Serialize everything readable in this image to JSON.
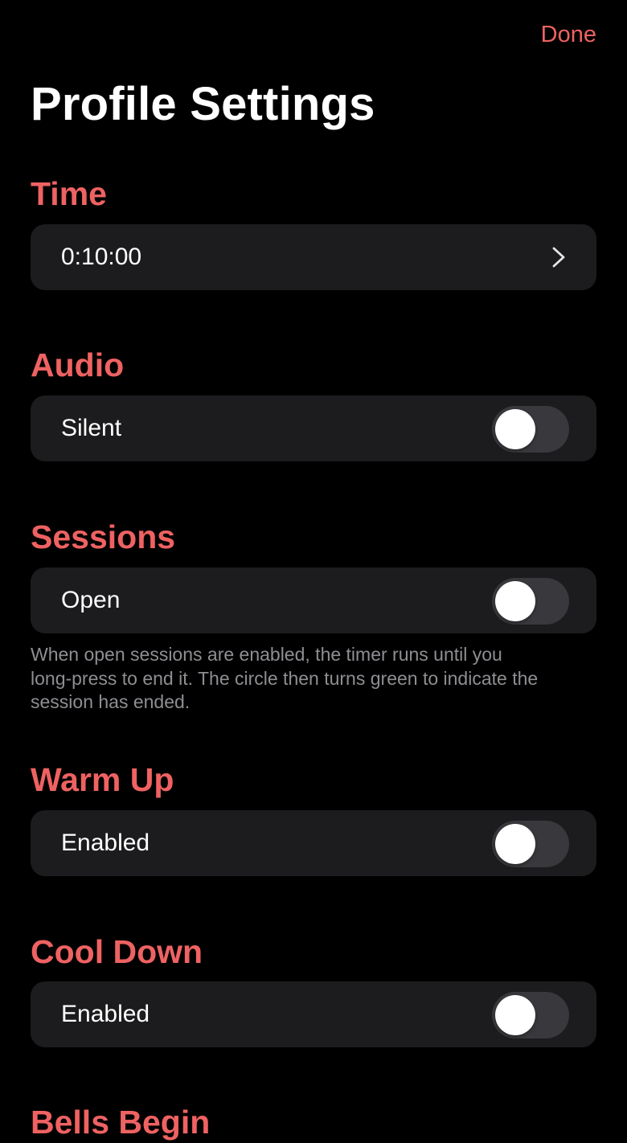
{
  "header": {
    "done_label": "Done",
    "title": "Profile Settings"
  },
  "colors": {
    "accent": "#ef6262",
    "background": "#000000",
    "cell": "#1c1c1e",
    "toggle_off": "#39393d",
    "footnote": "#8e8e93"
  },
  "sections": {
    "time": {
      "title": "Time",
      "value": "0:10:00",
      "icon": "chevron-right-icon"
    },
    "audio": {
      "title": "Audio",
      "label": "Silent",
      "enabled": false
    },
    "sessions": {
      "title": "Sessions",
      "label": "Open",
      "enabled": false,
      "footnote": "When open sessions are enabled, the timer runs until you long-press to end it. The circle then turns green to indicate the session has ended."
    },
    "warm_up": {
      "title": "Warm Up",
      "label": "Enabled",
      "enabled": false
    },
    "cool_down": {
      "title": "Cool Down",
      "label": "Enabled",
      "enabled": false
    },
    "bells_partial": {
      "title": "Bells Begin"
    }
  }
}
